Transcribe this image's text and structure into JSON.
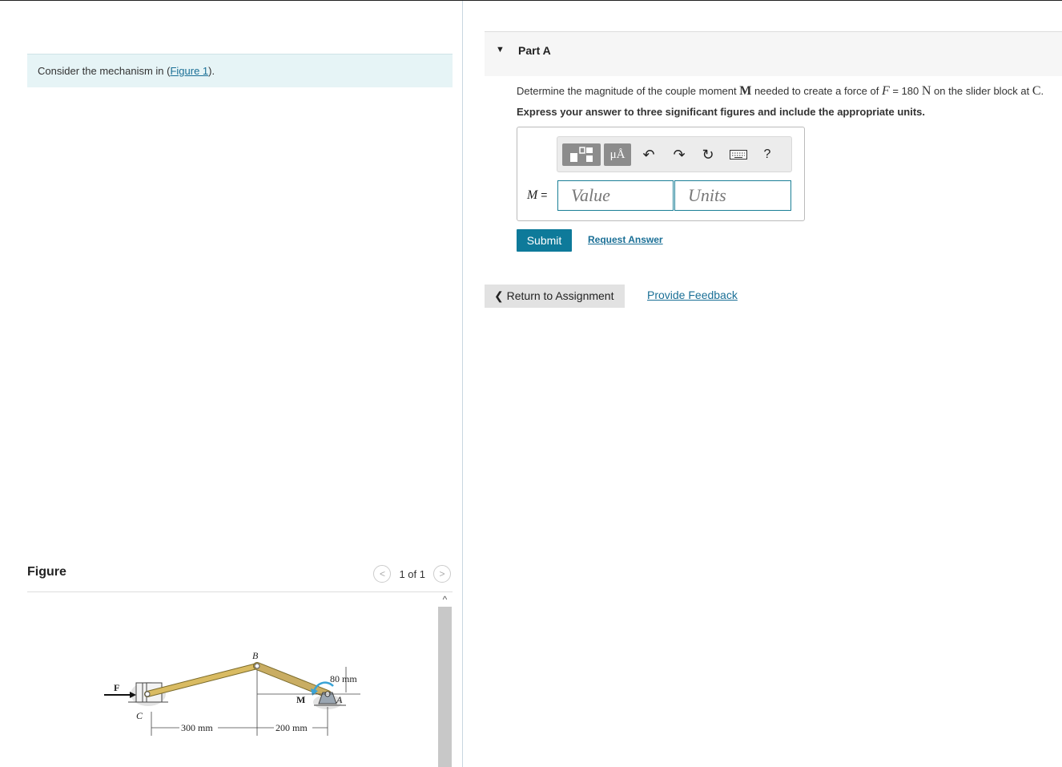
{
  "intro": {
    "prefix": "Consider the mechanism in (",
    "link": "Figure 1",
    "suffix": ")."
  },
  "figure": {
    "title": "Figure",
    "pager_text": "1 of 1",
    "labels": {
      "F": "F",
      "C": "C",
      "B": "B",
      "M": "M",
      "A": "A",
      "dim_80": "80 mm",
      "dim_300": "300 mm",
      "dim_200": "200 mm"
    }
  },
  "part": {
    "title": "Part A",
    "question": {
      "t1": "Determine the magnitude of the couple moment ",
      "M": "M",
      "t2": " needed to create a force of ",
      "F": "F",
      "t3": " = 180 ",
      "N": "N",
      "t4": " on the slider block at ",
      "C": "C",
      "t5": "."
    },
    "instruction": "Express your answer to three significant figures and include the appropriate units.",
    "answer_label_var": "M",
    "answer_label_eq": " =",
    "value_placeholder": "Value",
    "units_placeholder": "Units",
    "toolbar": {
      "mu_label": "μÅ",
      "undo": "↶",
      "redo": "↷",
      "reset": "↻",
      "help": "?"
    },
    "submit_label": "Submit",
    "request_label": "Request Answer"
  },
  "footer": {
    "return_label": "Return to Assignment",
    "feedback_label": "Provide Feedback"
  }
}
